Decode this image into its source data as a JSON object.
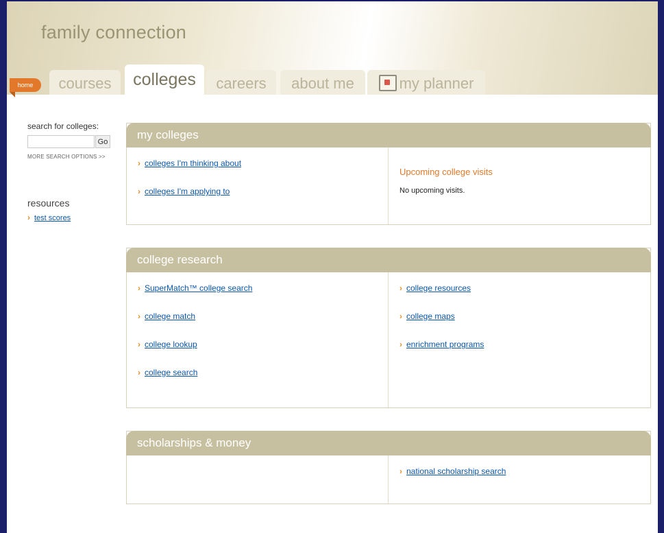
{
  "header": {
    "brand": "family connection"
  },
  "tabs": {
    "home": "home",
    "courses": "courses",
    "colleges": "colleges",
    "careers": "careers",
    "about_me": "about me",
    "my_planner": "my planner"
  },
  "sidebar": {
    "search_label": "search for colleges:",
    "search_placeholder": "",
    "go_label": "Go",
    "more_options": "MORE SEARCH OPTIONS >>",
    "resources_title": "resources",
    "resources_links": [
      "test scores"
    ]
  },
  "panels": {
    "my_colleges": {
      "title": "my colleges",
      "left_links": [
        "colleges I'm thinking about",
        "colleges I'm applying to"
      ],
      "visits_title": "Upcoming college visits",
      "visits_text": "No upcoming visits."
    },
    "college_research": {
      "title": "college research",
      "left_links": [
        "SuperMatch™ college search",
        "college match",
        "college lookup",
        "college search"
      ],
      "right_links": [
        "college resources",
        "college maps",
        "enrichment programs"
      ]
    },
    "scholarships": {
      "title": "scholarships & money",
      "right_links": [
        "national scholarship search"
      ]
    }
  },
  "icons": {
    "arrow": "chevron-right-icon",
    "planner": "calendar-icon"
  },
  "colors": {
    "frame": "#1b1f6a",
    "accent": "#e2792a",
    "panel_header": "#c7c0a0",
    "link": "#0b56a8"
  }
}
